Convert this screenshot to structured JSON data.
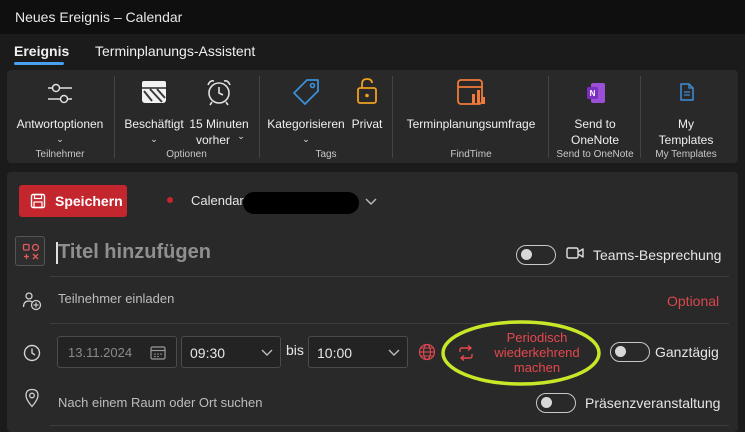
{
  "window": {
    "title": "Neues Ereignis – Calendar"
  },
  "tabs": [
    {
      "label": "Ereignis",
      "active": true
    },
    {
      "label": "Terminplanungs-Assistent",
      "active": false
    }
  ],
  "ribbon": {
    "antwortoptionen": "Antwortoptionen",
    "beschaeftigt": "Beschäftigt",
    "reminder_1": "15 Minuten",
    "reminder_2": "vorher",
    "kategorisieren": "Kategorisieren",
    "privat": "Privat",
    "terminplanungsumfrage": "Terminplanungsumfrage",
    "onenote_1": "Send to",
    "onenote_2": "OneNote",
    "templates_1": "My",
    "templates_2": "Templates",
    "groups": {
      "teilnehmer": "Teilnehmer",
      "optionen": "Optionen",
      "tags": "Tags",
      "findtime": "FindTime",
      "send_onenote": "Send to OneNote",
      "my_templates": "My Templates"
    }
  },
  "form": {
    "save_label": "Speichern",
    "calendar_label": "Calendar",
    "title_placeholder": "Titel hinzufügen",
    "teams_label": "Teams-Besprechung",
    "attendees_placeholder": "Teilnehmer einladen",
    "optional_label": "Optional",
    "start_date": "13.11.2024",
    "start_time": "09:30",
    "bis_label": "bis",
    "end_time": "10:00",
    "recurring_1": "Periodisch",
    "recurring_2": "wiederkehrend",
    "recurring_3": "machen",
    "allday_label": "Ganztägig",
    "location_placeholder": "Nach einem Raum oder Ort suchen",
    "inperson_label": "Präsenzveranstaltung"
  },
  "colors": {
    "accent_red": "#c4262e",
    "recurring_text": "#e5484d",
    "highlight_ellipse": "#c6e829",
    "tab_underline": "#4aa0f0"
  }
}
